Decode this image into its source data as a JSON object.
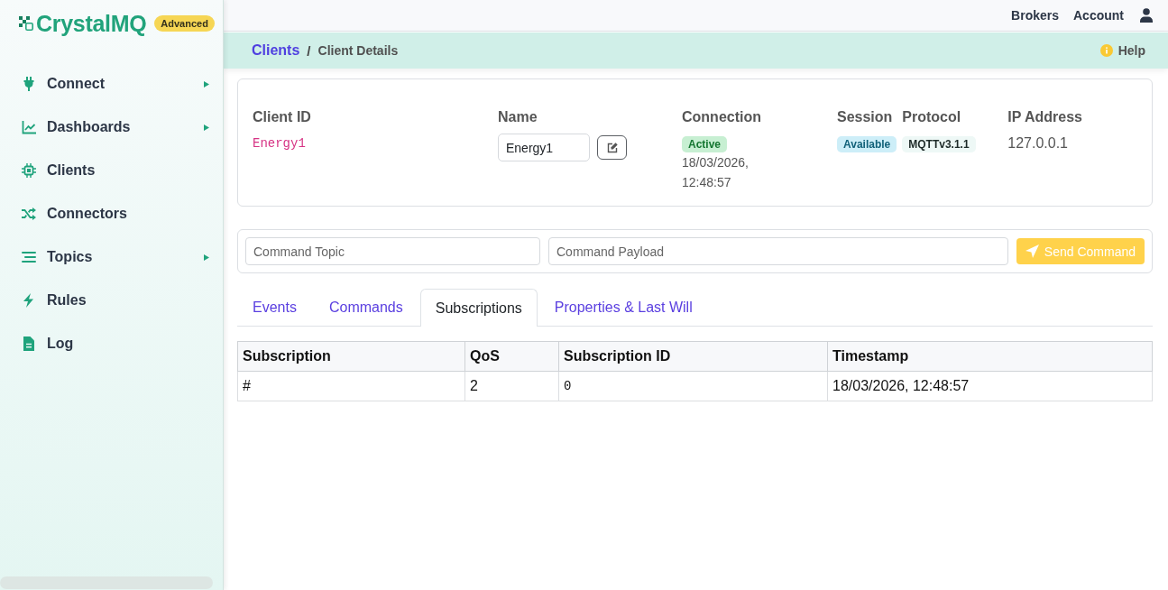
{
  "sidebar": {
    "logo": {
      "text": "CrystalMQ",
      "badge": "Advanced"
    },
    "items": [
      {
        "label": "Connect",
        "has_submenu": true
      },
      {
        "label": "Dashboards",
        "has_submenu": true
      },
      {
        "label": "Clients",
        "has_submenu": false
      },
      {
        "label": "Connectors",
        "has_submenu": false
      },
      {
        "label": "Topics",
        "has_submenu": true
      },
      {
        "label": "Rules",
        "has_submenu": false
      },
      {
        "label": "Log",
        "has_submenu": false
      }
    ]
  },
  "top_bar": {
    "links": [
      "Brokers",
      "Account"
    ]
  },
  "breadcrumb": {
    "items": [
      {
        "label": "Clients",
        "kind": "link"
      },
      {
        "label": "Client Details",
        "kind": "current"
      }
    ],
    "separator": "/",
    "help": "Help"
  },
  "client_details": {
    "fields": [
      {
        "label": "Client ID",
        "kind": "code",
        "value": "Energy1"
      },
      {
        "label": "Name",
        "kind": "input",
        "value": "Energy1"
      },
      {
        "label": "Connection",
        "kind": "status",
        "badge": {
          "text": "Active",
          "color": "#c7efd2"
        },
        "value": "18/03/2026, 12:48:57"
      },
      {
        "label": "Session",
        "kind": "badge",
        "badge": {
          "text": "Available",
          "color": "#cdeef8"
        }
      },
      {
        "label": "Protocol",
        "kind": "badge",
        "badge": {
          "text": "MQTTv3.1.1",
          "color": "#eef8f6"
        }
      },
      {
        "label": "IP Address",
        "kind": "text",
        "value": "127.0.0.1"
      }
    ]
  },
  "command_bar": {
    "topic": {
      "placeholder": "Command Topic"
    },
    "payload": {
      "placeholder": "Command Payload"
    },
    "send_button": {
      "label": "Send Command",
      "disabled": true
    }
  },
  "tabs": [
    {
      "label": "Events",
      "selected": false
    },
    {
      "label": "Commands",
      "selected": false
    },
    {
      "label": "Subscriptions",
      "selected": true
    },
    {
      "label": "Properties & Last Will",
      "selected": false
    }
  ],
  "table": {
    "columns": [
      "Subscription",
      "QoS",
      "Subscription ID",
      "Timestamp"
    ],
    "rows": [
      [
        {
          "text": "#",
          "kind": "text"
        },
        {
          "text": "2",
          "kind": "text"
        },
        {
          "text": "0",
          "kind": "code"
        },
        {
          "text": "18/03/2026, 12:48:57",
          "kind": "text"
        }
      ]
    ]
  }
}
